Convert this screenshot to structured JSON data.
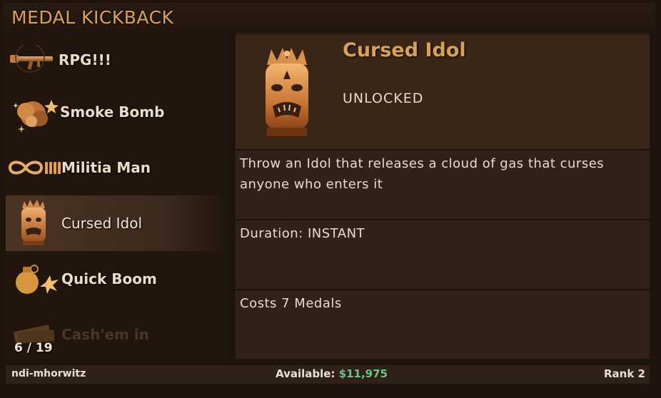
{
  "header": {
    "title": "MEDAL KICKBACK"
  },
  "list": {
    "items": [
      {
        "label": "RPG!!!",
        "icon": "rpg-launcher-icon"
      },
      {
        "label": "Smoke Bomb",
        "icon": "smoke-bomb-icon"
      },
      {
        "label": "Militia Man",
        "icon": "infinity-ammo-icon"
      },
      {
        "label": "Cursed Idol",
        "icon": "cursed-idol-icon",
        "selected": true
      },
      {
        "label": "Quick Boom",
        "icon": "grenade-icon"
      },
      {
        "label": "Cash'em in",
        "icon": "cash-icon"
      }
    ],
    "counter": "6 / 19"
  },
  "detail": {
    "name": "Cursed Idol",
    "status": "UNLOCKED",
    "description": "Throw an Idol that releases a cloud of gas that curses anyone who enters it",
    "duration": "Duration: INSTANT",
    "cost": "Costs 7 Medals",
    "icon": "cursed-idol-icon"
  },
  "status_bar": {
    "username": "ndi-mhorwitz",
    "available_label": "Available:",
    "available_value": "$11,975",
    "rank": "Rank 2"
  },
  "colors": {
    "accent_gold": "#d6a25b",
    "money_green": "#6fc28a",
    "panel_bg": "#2a1b13",
    "selected_bg": "#4b3424"
  }
}
